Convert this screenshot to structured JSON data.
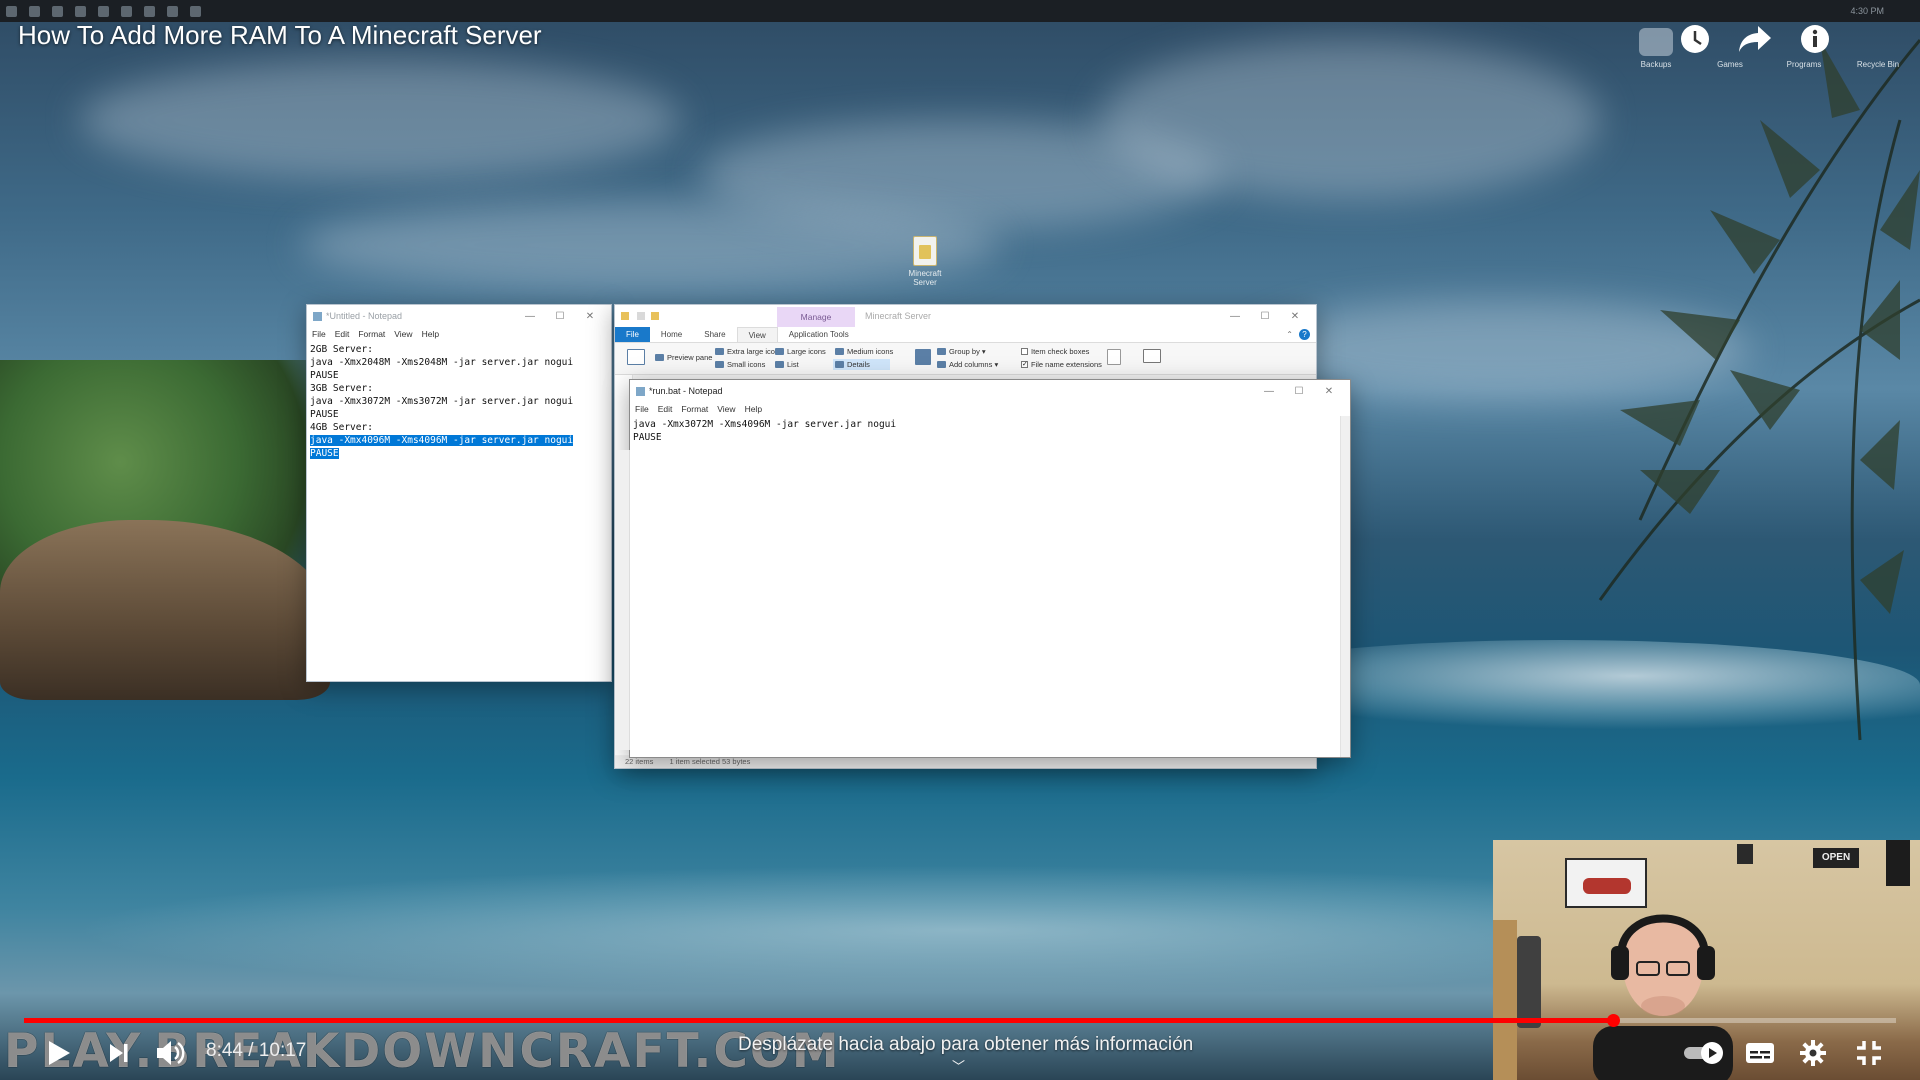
{
  "video": {
    "title": "How To Add More RAM To A Minecraft Server",
    "time_current": "8:44",
    "time_separator": "/",
    "time_total": "10:17",
    "progress_fraction": 0.849,
    "scroll_hint": "Desplázate hacia abajo para obtener más información",
    "watermark": "PLAY.BREAKDOWNCRAFT.COM",
    "accent_color": "#ff0000"
  },
  "top_actions": {
    "watch_later_icon": "clock-icon",
    "share_icon": "share-arrow-icon",
    "info_icon": "info-icon"
  },
  "desktop": {
    "icons": [
      {
        "label": "Backups"
      },
      {
        "label": "Games"
      },
      {
        "label": "Programs"
      },
      {
        "label": "Recycle Bin"
      }
    ],
    "folder_label": "Minecraft Server",
    "clock": "4:30 PM"
  },
  "notepad1": {
    "title": "*Untitled - Notepad",
    "menu": [
      "File",
      "Edit",
      "Format",
      "View",
      "Help"
    ],
    "lines": [
      "2GB Server:",
      "java -Xmx2048M -Xms2048M -jar server.jar nogui",
      "PAUSE",
      "",
      "3GB Server:",
      "java -Xmx3072M -Xms3072M -jar server.jar nogui",
      "PAUSE",
      "",
      "4GB Server:"
    ],
    "selected_lines": [
      "java -Xmx4096M -Xms4096M -jar server.jar nogui",
      "PAUSE"
    ]
  },
  "explorer": {
    "title": "Minecraft Server",
    "manage_tab": "Manage",
    "tabs": [
      "File",
      "Home",
      "Share",
      "View",
      "Application Tools"
    ],
    "ribbon": {
      "preview_pane": "Preview pane",
      "extra_large_icons": "Extra large icons",
      "large_icons": "Large icons",
      "medium_icons": "Medium icons",
      "small_icons": "Small icons",
      "list": "List",
      "details": "Details",
      "group_by": "Group by ▾",
      "add_columns": "Add columns ▾",
      "item_check_boxes": "Item check boxes",
      "file_name_extensions": "File name extensions"
    },
    "status_items": "22 items",
    "status_selected": "1 item selected  53 bytes"
  },
  "notepad2": {
    "title": "*run.bat - Notepad",
    "menu": [
      "File",
      "Edit",
      "Format",
      "View",
      "Help"
    ],
    "lines": [
      "java -Xmx3072M -Xms4096M -jar server.jar nogui",
      "PAUSE"
    ]
  },
  "webcam": {
    "sign_text": "OPEN"
  }
}
